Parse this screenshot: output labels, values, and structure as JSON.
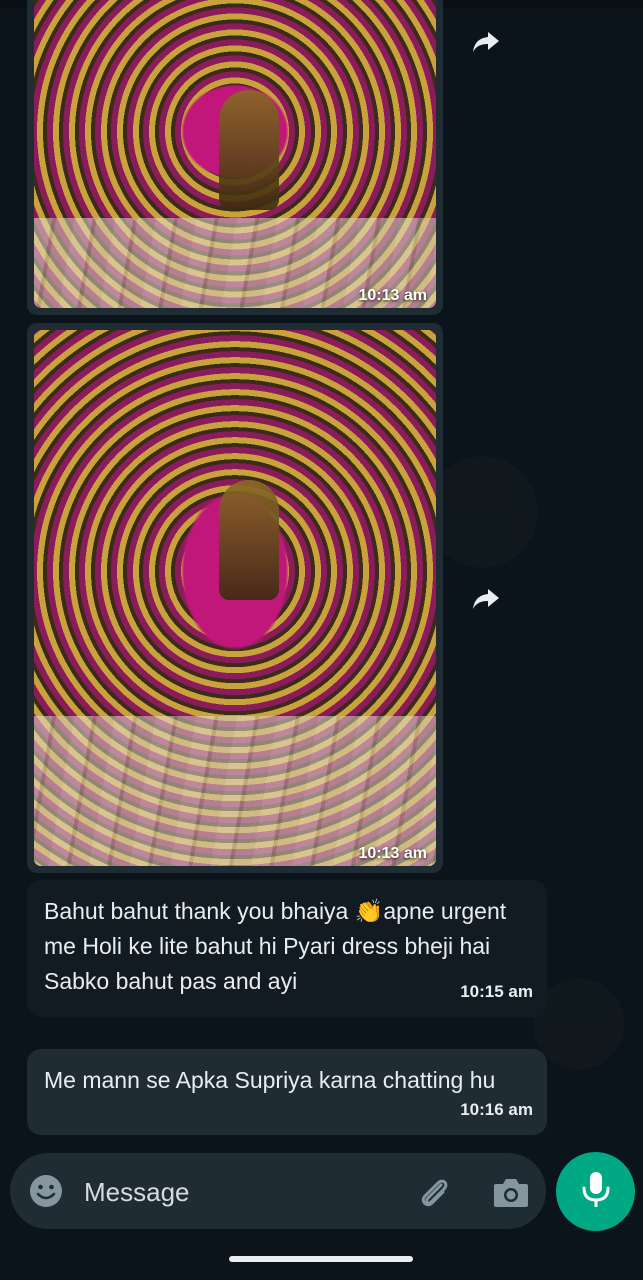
{
  "chat": {
    "messages": [
      {
        "type": "image",
        "time": "10:13 am"
      },
      {
        "type": "image",
        "time": "10:13 am"
      },
      {
        "type": "text",
        "text": "Bahut bahut thank you bhaiya 👏apne urgent me Holi ke lite bahut hi Pyari dress bheji hai Sabko bahut pas and ayi",
        "time": "10:15 am"
      },
      {
        "type": "text",
        "text": "Me mann se Apka Supriya karna chatting hu",
        "time": "10:16 am"
      }
    ]
  },
  "composer": {
    "placeholder": "Message",
    "icons": {
      "emoji": "emoji-icon",
      "attach": "paperclip-icon",
      "camera": "camera-icon",
      "send": "microphone-icon"
    }
  },
  "colors": {
    "background": "#0b141a",
    "incoming_bubble": "#1f2c34",
    "accent": "#00a884"
  }
}
